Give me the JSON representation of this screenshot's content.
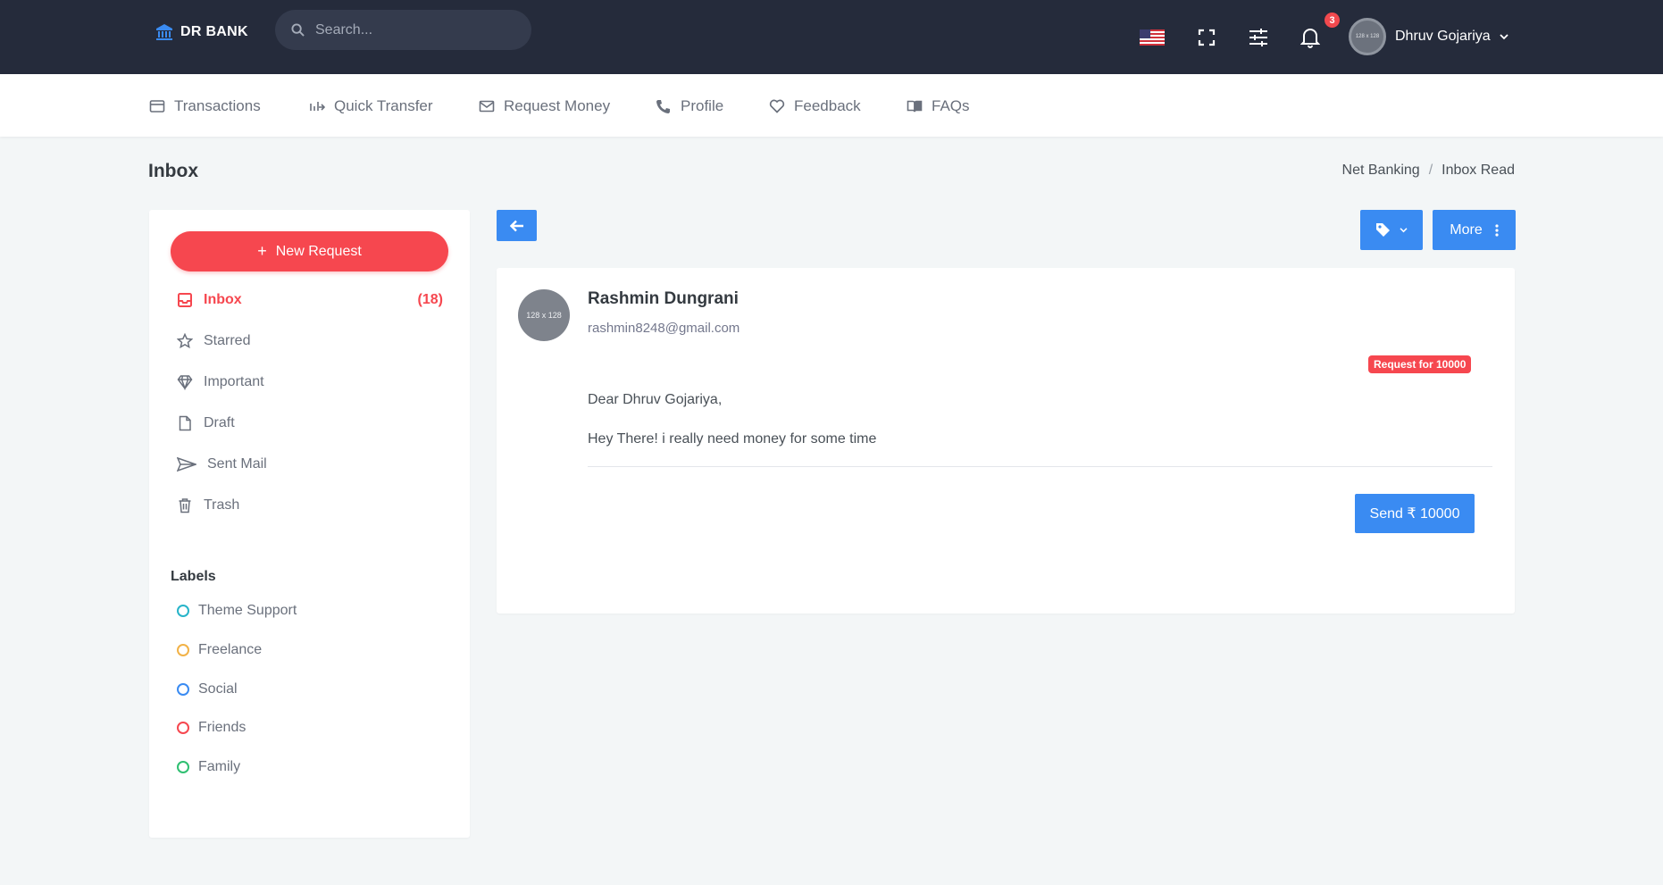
{
  "brand": {
    "name": "DR BANK"
  },
  "search": {
    "placeholder": "Search..."
  },
  "notifications": {
    "count": "3"
  },
  "user": {
    "name": "Dhruv Gojariya",
    "avatar_text": "128 x 128"
  },
  "nav": [
    {
      "label": "Transactions",
      "icon": "card-icon"
    },
    {
      "label": "Quick Transfer",
      "icon": "transfer-icon"
    },
    {
      "label": "Request Money",
      "icon": "mail-money-icon"
    },
    {
      "label": "Profile",
      "icon": "phone-user-icon"
    },
    {
      "label": "Feedback",
      "icon": "heart-icon"
    },
    {
      "label": "FAQs",
      "icon": "book-icon"
    }
  ],
  "page": {
    "title": "Inbox"
  },
  "breadcrumb": {
    "first": "Net Banking",
    "separator": "/",
    "current": "Inbox Read"
  },
  "sidebar": {
    "new_request": "New Request",
    "folders": [
      {
        "label": "Inbox",
        "count": "(18)",
        "active": true
      },
      {
        "label": "Starred"
      },
      {
        "label": "Important"
      },
      {
        "label": "Draft"
      },
      {
        "label": "Sent Mail"
      },
      {
        "label": "Trash"
      }
    ],
    "labels_heading": "Labels",
    "labels": [
      {
        "label": "Theme Support",
        "color": "#27b4c9"
      },
      {
        "label": "Freelance",
        "color": "#f2b247"
      },
      {
        "label": "Social",
        "color": "#3a8bf2"
      },
      {
        "label": "Friends",
        "color": "#f6474f"
      },
      {
        "label": "Family",
        "color": "#2fbf71"
      }
    ]
  },
  "toolbar": {
    "more_label": "More"
  },
  "mail": {
    "avatar_text": "128 x 128",
    "sender_name": "Rashmin Dungrani",
    "sender_email": "rashmin8248@gmail.com",
    "badge": "Request for 10000",
    "greeting": "Dear Dhruv Gojariya,",
    "body": "Hey There! i really need money for some time",
    "action_label": "Send ₹ 10000"
  },
  "colors": {
    "topbar": "#252b3b",
    "accent": "#3a8bf2",
    "danger": "#f6474f"
  }
}
